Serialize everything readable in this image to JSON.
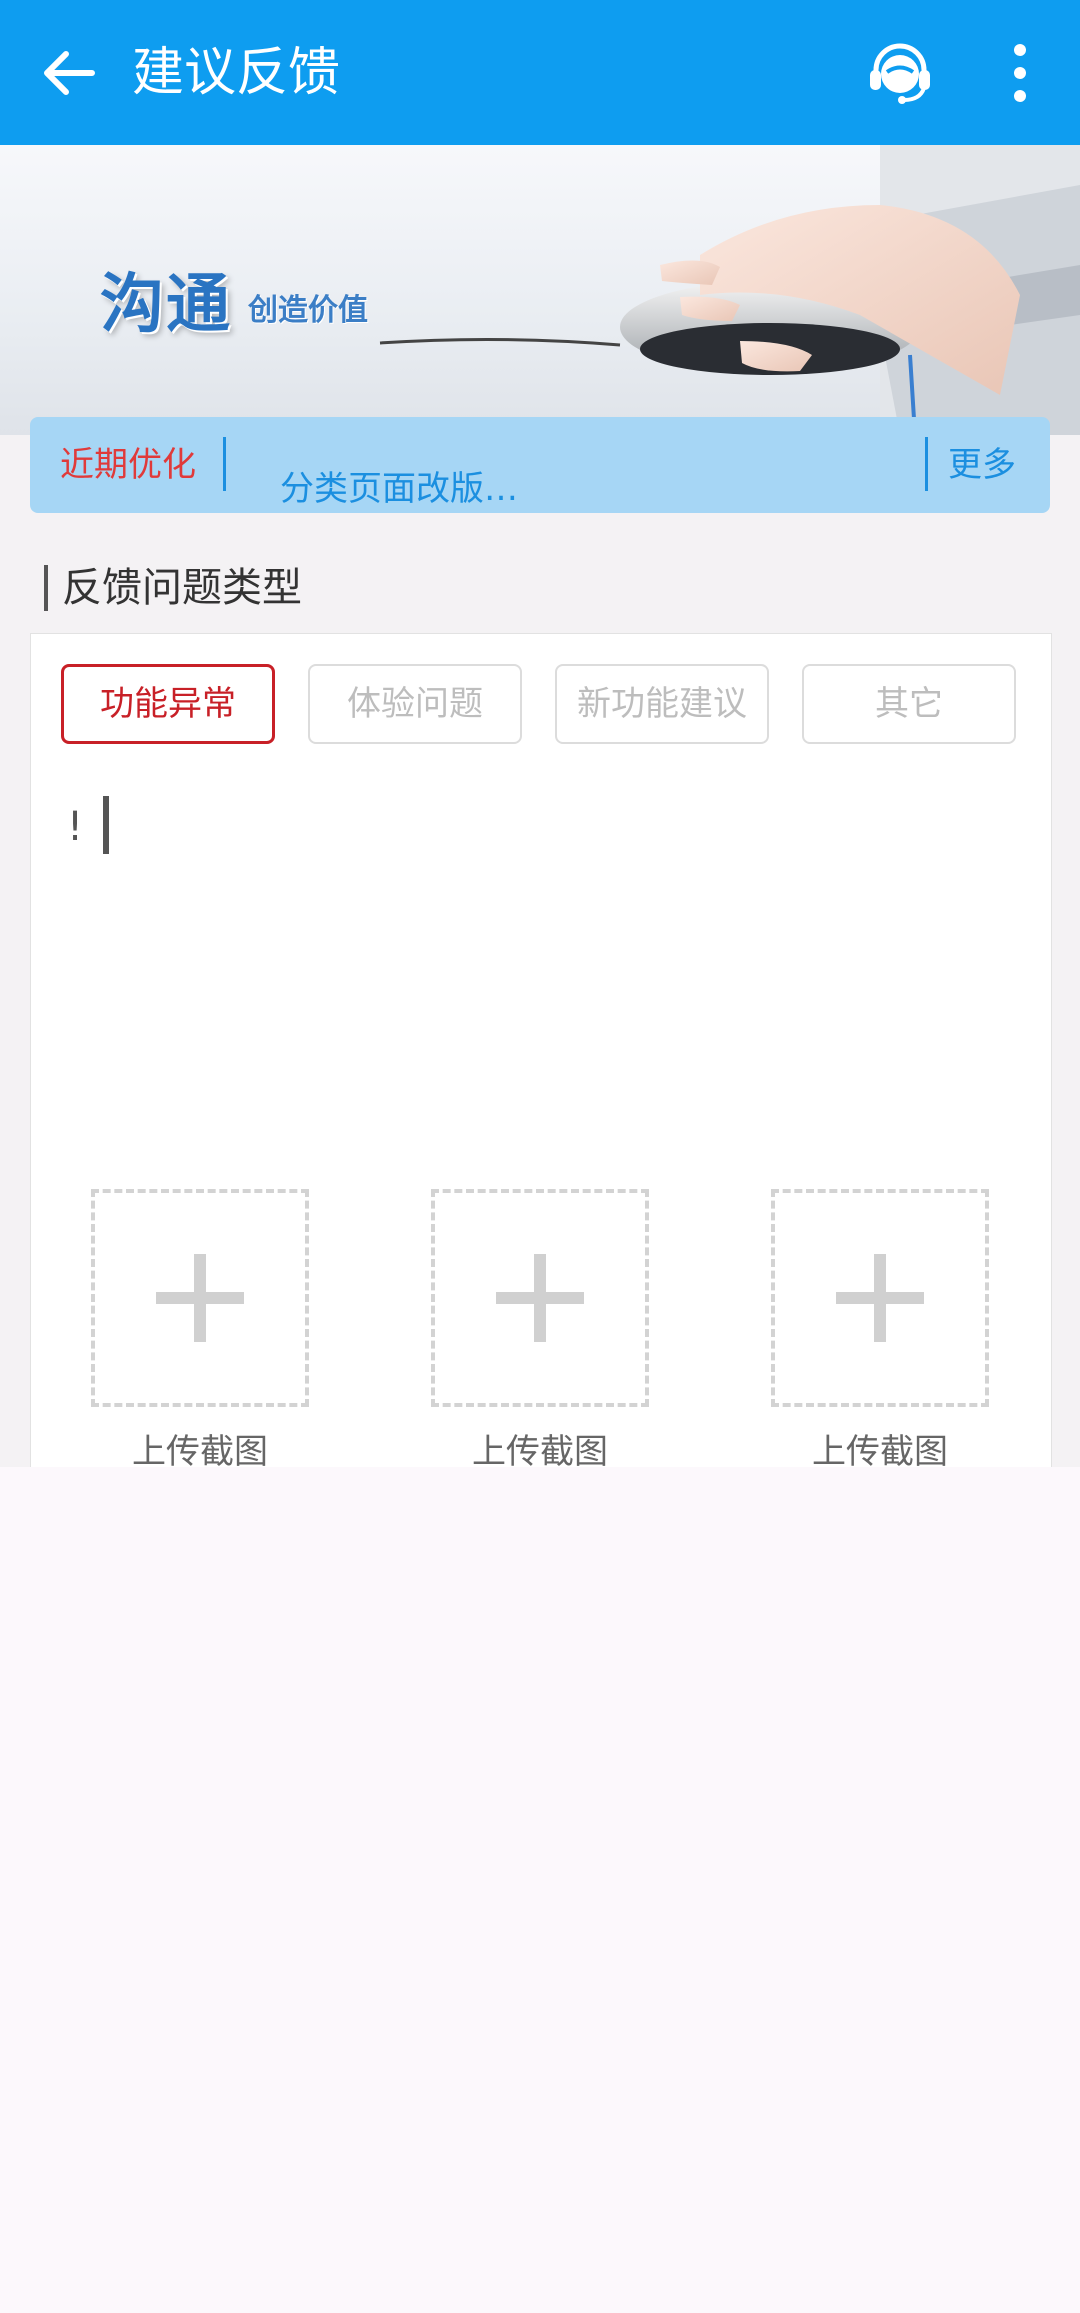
{
  "header": {
    "title": "建议反馈",
    "back_icon": "arrow-left-icon",
    "service_icon": "customer-service-headset-icon",
    "more_icon": "more-vertical-icon",
    "background": "#0e9df0"
  },
  "banner": {
    "headline": "沟通",
    "slogan": "创造价值"
  },
  "news": {
    "label": "近期优化",
    "ticker": "分类页面改版…",
    "more": "更多"
  },
  "feedback": {
    "section_title": "反馈问题类型",
    "types": [
      "功能异常",
      "体验问题",
      "新功能建议",
      "其它"
    ],
    "selected_type": "功能异常",
    "accent_color": "#c82027",
    "input_value": "!",
    "uploads": [
      {
        "label": "上传截图",
        "icon": "plus-icon"
      },
      {
        "label": "上传截图",
        "icon": "plus-icon"
      },
      {
        "label": "上传截图",
        "icon": "plus-icon"
      }
    ]
  }
}
